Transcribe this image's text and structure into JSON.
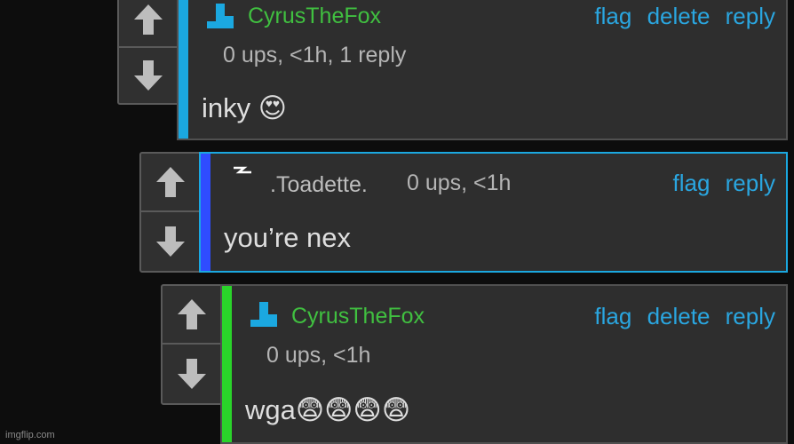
{
  "comments": [
    {
      "username": "CyrusTheFox",
      "meta": "0 ups, <1h, 1 reply",
      "text": "inky 😍",
      "actions": [
        "flag",
        "delete",
        "reply"
      ],
      "bar_color": "#1ba8e0",
      "avatar_icon": "blue-square-avatar-icon"
    },
    {
      "username": ".Toadette.",
      "meta": "0 ups, <1h",
      "text": "you’re nex",
      "actions": [
        "flag",
        "reply"
      ],
      "bar_color": "#2f4cff",
      "avatar_icon": "lightning-avatar-icon"
    },
    {
      "username": "CyrusTheFox",
      "meta": "0 ups, <1h",
      "text": "wga😨😨😨😨",
      "actions": [
        "flag",
        "delete",
        "reply"
      ],
      "bar_color": "#2ad42a",
      "avatar_icon": "blue-square-avatar-icon"
    }
  ],
  "icons": {
    "upvote": "up-arrow-icon",
    "downvote": "down-arrow-icon"
  },
  "colors": {
    "link": "#2aa6e0",
    "username": "#40c040",
    "background": "#0d0d0d"
  },
  "watermark": "imgflip.com"
}
